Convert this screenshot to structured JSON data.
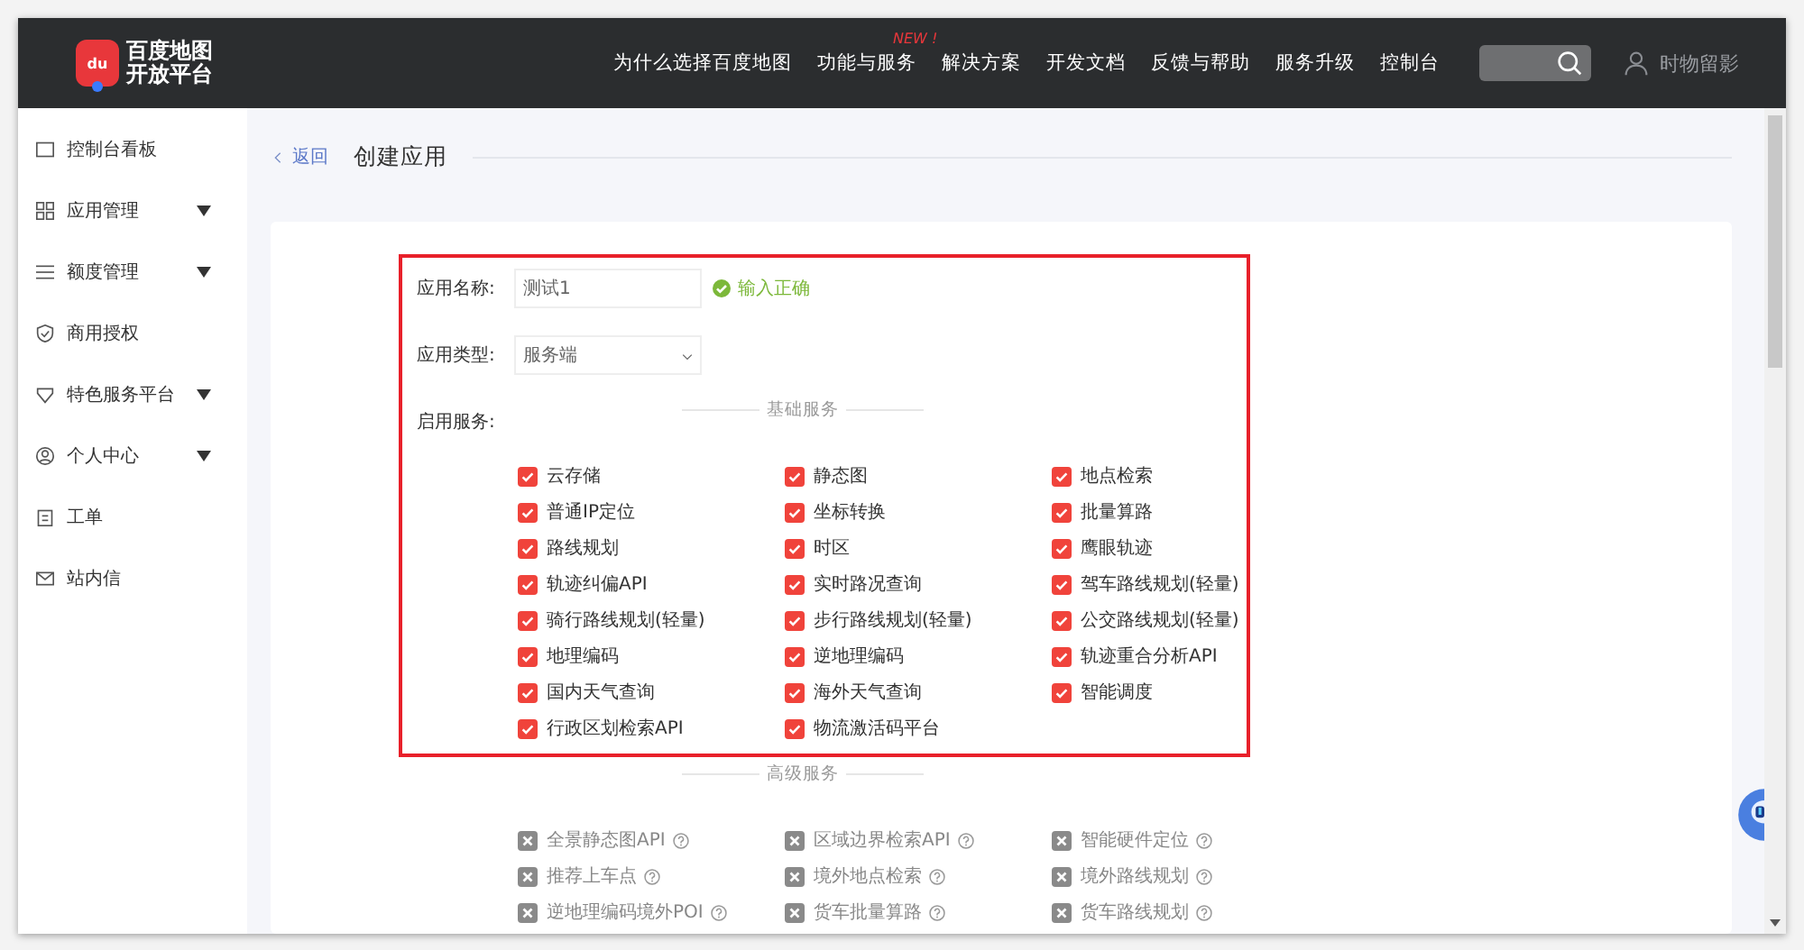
{
  "header": {
    "logo_line_1": "百度地图",
    "logo_line_2": "开放平台",
    "logo_badge": "du",
    "nav": [
      {
        "label": "为什么选择百度地图"
      },
      {
        "label": "功能与服务",
        "badge": "NEW !"
      },
      {
        "label": "解决方案"
      },
      {
        "label": "开发文档"
      },
      {
        "label": "反馈与帮助"
      },
      {
        "label": "服务升级"
      },
      {
        "label": "控制台"
      }
    ],
    "user": "时物留影"
  },
  "sidebar": {
    "items": [
      {
        "label": "控制台看板",
        "expandable": false
      },
      {
        "label": "应用管理",
        "expandable": true
      },
      {
        "label": "额度管理",
        "expandable": true
      },
      {
        "label": "商用授权",
        "expandable": false
      },
      {
        "label": "特色服务平台",
        "expandable": true
      },
      {
        "label": "个人中心",
        "expandable": true
      },
      {
        "label": "工单",
        "expandable": false
      },
      {
        "label": "站内信",
        "expandable": false
      }
    ]
  },
  "breadcrumb": {
    "back": "返回",
    "title": "创建应用"
  },
  "form": {
    "name_label": "应用名称:",
    "name_value": "测试1",
    "name_status": "输入正确",
    "type_label": "应用类型:",
    "type_value": "服务端",
    "services_label": "启用服务:",
    "sections": [
      {
        "title": "基础服务",
        "help_icons": false,
        "items": [
          {
            "label": "云存储",
            "checked": true,
            "disabled": false
          },
          {
            "label": "静态图",
            "checked": true,
            "disabled": false
          },
          {
            "label": "地点检索",
            "checked": true,
            "disabled": false
          },
          {
            "label": "普通IP定位",
            "checked": true,
            "disabled": false
          },
          {
            "label": "坐标转换",
            "checked": true,
            "disabled": false
          },
          {
            "label": "批量算路",
            "checked": true,
            "disabled": false
          },
          {
            "label": "路线规划",
            "checked": true,
            "disabled": false
          },
          {
            "label": "时区",
            "checked": true,
            "disabled": false
          },
          {
            "label": "鹰眼轨迹",
            "checked": true,
            "disabled": false
          },
          {
            "label": "轨迹纠偏API",
            "checked": true,
            "disabled": false
          },
          {
            "label": "实时路况查询",
            "checked": true,
            "disabled": false
          },
          {
            "label": "驾车路线规划(轻量)",
            "checked": true,
            "disabled": false
          },
          {
            "label": "骑行路线规划(轻量)",
            "checked": true,
            "disabled": false
          },
          {
            "label": "步行路线规划(轻量)",
            "checked": true,
            "disabled": false
          },
          {
            "label": "公交路线规划(轻量)",
            "checked": true,
            "disabled": false
          },
          {
            "label": "地理编码",
            "checked": true,
            "disabled": false
          },
          {
            "label": "逆地理编码",
            "checked": true,
            "disabled": false
          },
          {
            "label": "轨迹重合分析API",
            "checked": true,
            "disabled": false
          },
          {
            "label": "国内天气查询",
            "checked": true,
            "disabled": false
          },
          {
            "label": "海外天气查询",
            "checked": true,
            "disabled": false
          },
          {
            "label": "智能调度",
            "checked": true,
            "disabled": false
          },
          {
            "label": "行政区划检索API",
            "checked": true,
            "disabled": false
          },
          {
            "label": "物流激活码平台",
            "checked": true,
            "disabled": false
          }
        ]
      },
      {
        "title": "高级服务",
        "help_icons": true,
        "items": [
          {
            "label": "全景静态图API",
            "disabled": true
          },
          {
            "label": "区域边界检索API",
            "disabled": true
          },
          {
            "label": "智能硬件定位",
            "disabled": true
          },
          {
            "label": "推荐上车点",
            "disabled": true
          },
          {
            "label": "境外地点检索",
            "disabled": true
          },
          {
            "label": "境外路线规划",
            "disabled": true
          },
          {
            "label": "逆地理编码境外POI",
            "disabled": true
          },
          {
            "label": "货车批量算路",
            "disabled": true
          },
          {
            "label": "货车路线规划",
            "disabled": true
          }
        ]
      }
    ]
  }
}
